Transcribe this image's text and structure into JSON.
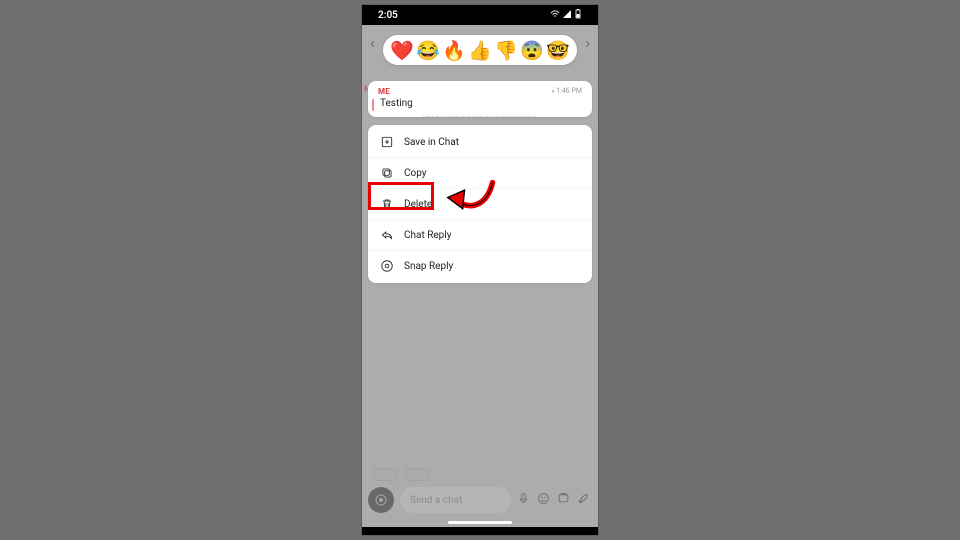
{
  "status": {
    "time": "2:05"
  },
  "reactions": {
    "items": [
      "❤️",
      "😂",
      "🔥",
      "👍",
      "👎",
      "😨",
      "🤓"
    ]
  },
  "message": {
    "sender": "ME",
    "time": "1:46 PM",
    "text": "Testing"
  },
  "divider_text": "YOU CHANGED THE GROUP NAME TO TESTING",
  "menu": {
    "items": [
      {
        "label": "Save in Chat",
        "icon": "save-in-chat-icon"
      },
      {
        "label": "Copy",
        "icon": "copy-icon"
      },
      {
        "label": "Delete",
        "icon": "trash-icon"
      },
      {
        "label": "Chat Reply",
        "icon": "reply-icon"
      },
      {
        "label": "Snap Reply",
        "icon": "camera-circle-icon"
      }
    ]
  },
  "input": {
    "placeholder": "Send a chat"
  },
  "sidebar_letter": "N",
  "annotation": {
    "highlight_target": "Delete"
  }
}
